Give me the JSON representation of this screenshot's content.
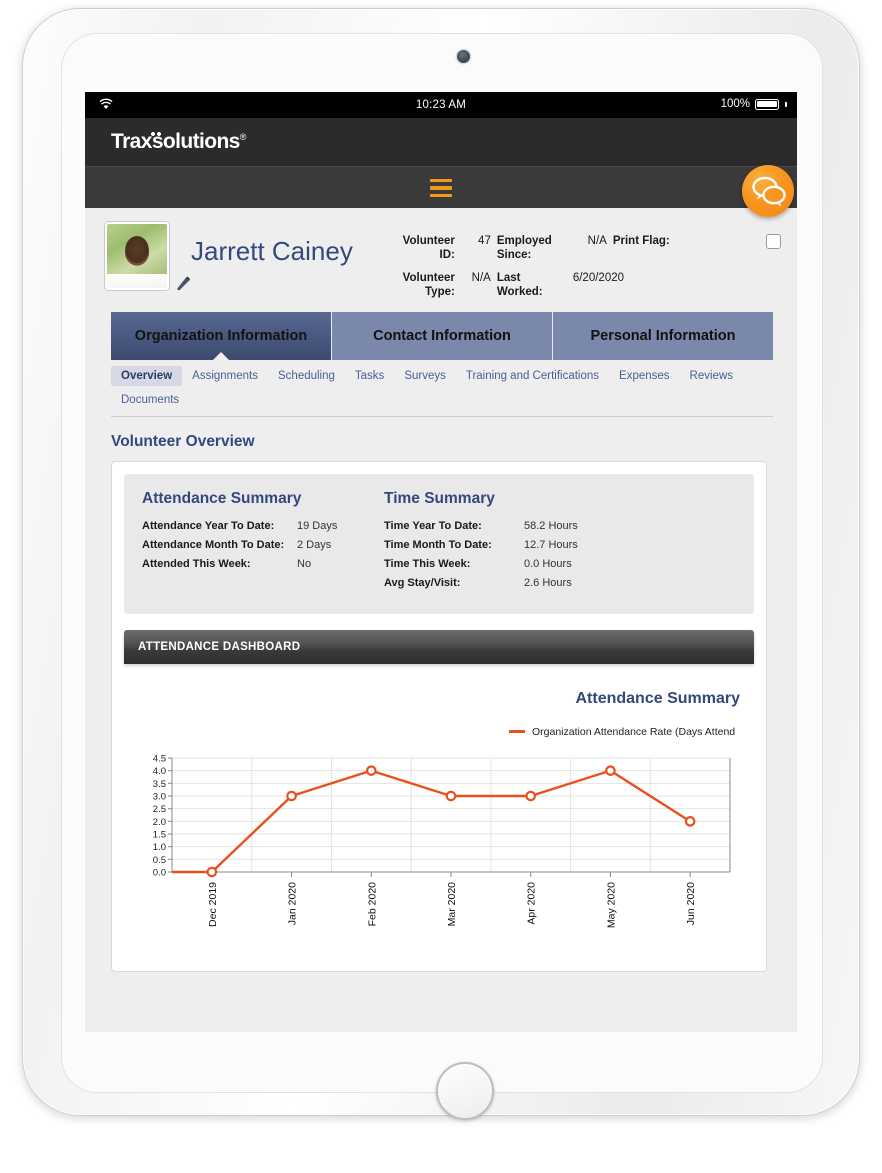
{
  "status_bar": {
    "wifi_icon": "wifi-icon",
    "time": "10:23 AM",
    "battery_percent": "100%",
    "battery_icon": "battery-full-icon"
  },
  "brand": {
    "name_part1": "Trax",
    "name_part2": "s",
    "name_part3": "olutions",
    "registered": "®"
  },
  "menu": {
    "hamburger_icon": "hamburger-menu-icon"
  },
  "chat": {
    "icon": "chat-bubbles-icon"
  },
  "profile": {
    "avatar_icon": "user-photo",
    "edit_icon": "pencil-edit-icon",
    "name": "Jarrett Cainey",
    "fields": [
      {
        "label": "Volunteer ID:",
        "value": "47"
      },
      {
        "label": "Employed Since:",
        "value": "N/A"
      },
      {
        "label": "Volunteer Type:",
        "value": "N/A"
      },
      {
        "label": "Last Worked:",
        "value": "6/20/2020"
      }
    ],
    "volunteer_id_label": "Volunteer ID:",
    "volunteer_id_value": "47",
    "employed_since_label": "Employed Since:",
    "employed_since_value": "N/A",
    "volunteer_type_label": "Volunteer Type:",
    "volunteer_type_value": "N/A",
    "last_worked_label": "Last Worked:",
    "last_worked_value": "6/20/2020",
    "print_flag_label": "Print Flag:",
    "print_flag_checked": false
  },
  "main_tabs": [
    {
      "label": "Organization Information",
      "active": true
    },
    {
      "label": "Contact Information",
      "active": false
    },
    {
      "label": "Personal Information",
      "active": false
    }
  ],
  "sub_tabs": [
    {
      "label": "Overview",
      "active": true
    },
    {
      "label": "Assignments",
      "active": false
    },
    {
      "label": "Scheduling",
      "active": false
    },
    {
      "label": "Tasks",
      "active": false
    },
    {
      "label": "Surveys",
      "active": false
    },
    {
      "label": "Training and Certifications",
      "active": false
    },
    {
      "label": "Expenses",
      "active": false
    },
    {
      "label": "Reviews",
      "active": false
    },
    {
      "label": "Documents",
      "active": false
    }
  ],
  "page_title": "Volunteer Overview",
  "attendance_summary": {
    "heading": "Attendance Summary",
    "rows": [
      {
        "label": "Attendance Year To Date:",
        "value": "19 Days"
      },
      {
        "label": "Attendance Month To Date:",
        "value": "2 Days"
      },
      {
        "label": "Attended This Week:",
        "value": "No"
      }
    ]
  },
  "time_summary": {
    "heading": "Time Summary",
    "rows": [
      {
        "label": "Time Year To Date:",
        "value": "58.2 Hours"
      },
      {
        "label": "Time Month To Date:",
        "value": "12.7 Hours"
      },
      {
        "label": "Time This Week:",
        "value": "0.0 Hours"
      },
      {
        "label": "Avg Stay/Visit:",
        "value": "2.6 Hours"
      }
    ]
  },
  "dashboard": {
    "header": "ATTENDANCE DASHBOARD"
  },
  "colors": {
    "brand_orange": "#f0991c",
    "chart_line": "#e8501d",
    "heading_navy": "#34487e",
    "tab_inactive": "#7a88ab",
    "tab_active": "#4b5b84"
  },
  "chart_data": {
    "type": "line",
    "title": "Attendance Summary",
    "legend": [
      "Organization Attendance Rate (Days Attend"
    ],
    "legend_position": "top-right",
    "legend_truncated": true,
    "categories": [
      "Dec 2019",
      "Jan 2020",
      "Feb 2020",
      "Mar 2020",
      "Apr 2020",
      "May 2020",
      "Jun 2020"
    ],
    "series": [
      {
        "name": "Organization Attendance Rate (Days Attend",
        "values": [
          0.0,
          3.0,
          4.0,
          3.0,
          3.0,
          4.0,
          2.0
        ]
      }
    ],
    "ylim": [
      0.0,
      4.5
    ],
    "ytick_labels": [
      "0.0",
      "0.5",
      "1.0",
      "1.5",
      "2.0",
      "2.5",
      "3.0",
      "3.5",
      "4.0",
      "4.5"
    ],
    "ytick_values": [
      0.0,
      0.5,
      1.0,
      1.5,
      2.0,
      2.5,
      3.0,
      3.5,
      4.0,
      4.5
    ],
    "xlabel": "",
    "ylabel": "",
    "grid": true,
    "xtick_rotation": 90,
    "marker": "open-circle"
  }
}
